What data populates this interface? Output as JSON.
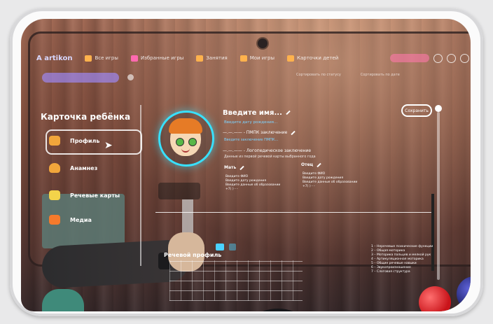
{
  "nav": {
    "logo": "A artikon",
    "items": [
      {
        "label": "Все игры",
        "icon": "games-icon"
      },
      {
        "label": "Избранные игры",
        "icon": "heart-icon"
      },
      {
        "label": "Занятия",
        "icon": "star-icon"
      },
      {
        "label": "Мои игры",
        "icon": "folder-icon"
      },
      {
        "label": "Карточки детей",
        "icon": "cards-icon"
      }
    ]
  },
  "top_links": {
    "left": "Сортировать по статусу",
    "right": "Сортировать по дате"
  },
  "sidebar": {
    "title": "Карточка ребёнка",
    "items": [
      {
        "label": "Профиль",
        "active": true,
        "icon": "profile-icon"
      },
      {
        "label": "Анамнез",
        "active": false,
        "icon": "heart-plus-icon"
      },
      {
        "label": "Речевые карты",
        "active": false,
        "icon": "card-icon"
      },
      {
        "label": "Медиа",
        "active": false,
        "icon": "camera-icon"
      }
    ]
  },
  "profile": {
    "name_placeholder": "Введите имя...",
    "birth_placeholder": "Введите дату рождения...",
    "pmpk_title": "—.—.—— - ПМПК заключение",
    "pmpk_placeholder": "Введите заключение ПМПК...",
    "logo_title": "—.—.—— - Логопедическое заключение",
    "logo_subtitle": "Данные из первой речевой карты выбранного года",
    "save_label": "Сохранить"
  },
  "mother": {
    "title": "Мать",
    "fio": "Введите ФИО",
    "birth": "Введите дату рождения",
    "education": "Введите данные об образовании",
    "phone": "+7(   )  -  -"
  },
  "father": {
    "title": "Отец",
    "fio": "Введите ФИО",
    "birth": "Введите дату рождения",
    "education": "Введите данные об образовании",
    "phone": "+7(   )  -  -"
  },
  "speech": {
    "title": "Речевой профиль",
    "legend": [
      "1 – Неречевые психические функции",
      "2 – Общая моторика",
      "3 – Моторика пальцев и мелкой рук",
      "4 – Артикуляционная моторика",
      "5 – Общие речевые навыки",
      "6 – Звукопроизношение",
      "7 – Слоговая структура"
    ]
  },
  "colors": {
    "accent": "#38e1ff",
    "avatar_hair": "#e67b26"
  }
}
